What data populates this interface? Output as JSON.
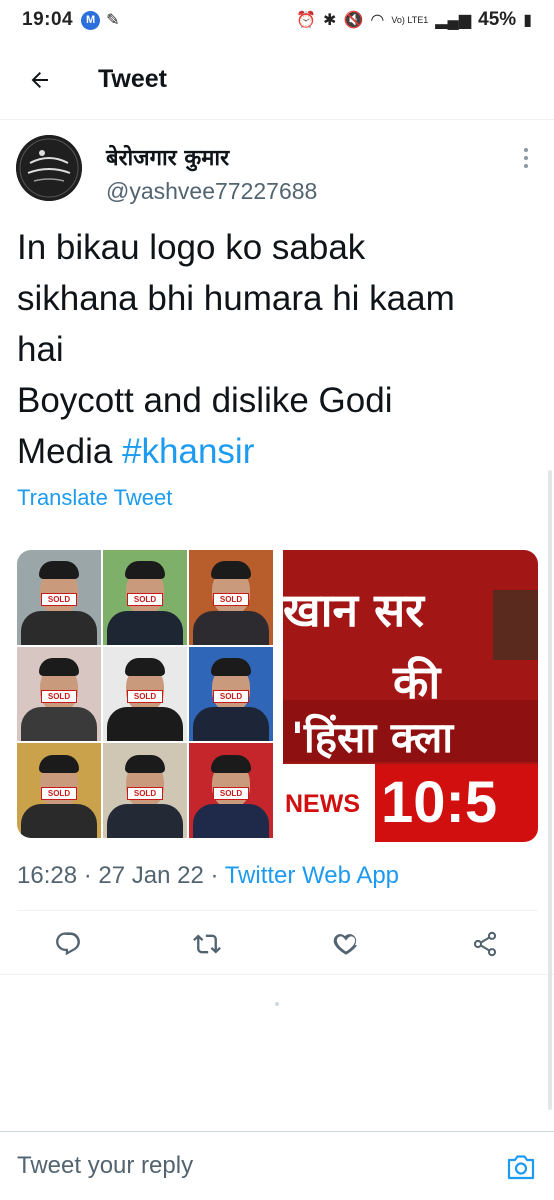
{
  "status_bar": {
    "time": "19:04",
    "m_badge": "M",
    "lte_label": "Vo) LTE1",
    "battery": "45%"
  },
  "app_bar": {
    "title": "Tweet"
  },
  "tweet": {
    "author_name": "बेरोजगार कुमार",
    "author_handle": "@yashvee77227688",
    "text_lines": [
      "In bikau logo ko sabak",
      "sikhana bhi humara hi kaam",
      "hai",
      "Boycott and dislike Godi",
      "Media "
    ],
    "hashtag": "#khansir",
    "translate_label": "Translate Tweet",
    "time": "16:28",
    "date": "27 Jan 22",
    "source": "Twitter Web App",
    "meta_sep": " · "
  },
  "media": {
    "left_badge": "SOLD",
    "right_line1": "खान सर",
    "right_line2": "की",
    "right_line3": "'हिंसा क्ला",
    "right_news": "NEWS",
    "right_time": "10:5"
  },
  "actions": [
    "reply-icon",
    "retweet-icon",
    "like-icon",
    "share-icon"
  ],
  "reply": {
    "placeholder": "Tweet your reply"
  },
  "colors": {
    "accent": "#1d9bf0",
    "secondary_text": "#536471",
    "news_red": "#d10f0f"
  }
}
